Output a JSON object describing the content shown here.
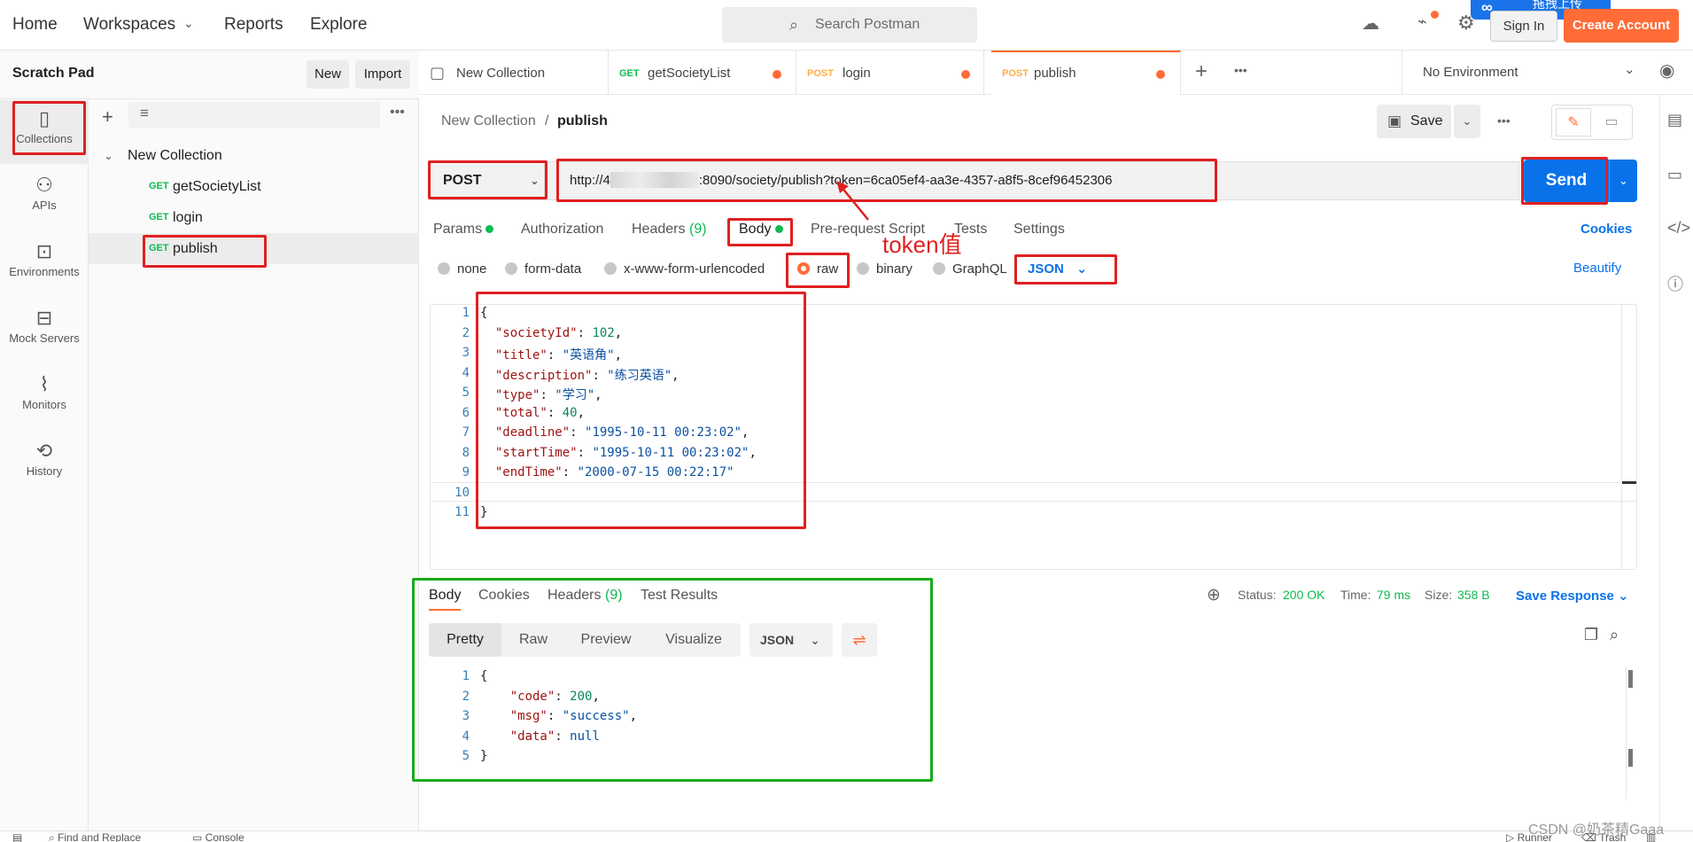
{
  "topbar": {
    "nav": [
      "Home",
      "Workspaces",
      "Reports",
      "Explore"
    ],
    "search_placeholder": "Search Postman",
    "sign_in": "Sign In",
    "create_account": "Create Account",
    "upload_badge": "拖拽上传"
  },
  "rail": {
    "items": [
      "Collections",
      "APIs",
      "Environments",
      "Mock Servers",
      "Monitors",
      "History"
    ]
  },
  "panel": {
    "title": "Scratch Pad",
    "new_label": "New",
    "import_label": "Import",
    "collection_name": "New Collection",
    "requests": [
      {
        "method": "GET",
        "name": "getSocietyList"
      },
      {
        "method": "GET",
        "name": "login"
      },
      {
        "method": "GET",
        "name": "publish"
      }
    ]
  },
  "tabs": {
    "items": [
      {
        "method": "",
        "name": "New Collection"
      },
      {
        "method": "GET",
        "name": "getSocietyList"
      },
      {
        "method": "POST",
        "name": "login"
      },
      {
        "method": "POST",
        "name": "publish"
      }
    ],
    "environment": "No Environment"
  },
  "request": {
    "breadcrumb_parent": "New Collection",
    "breadcrumb_sep": "/",
    "breadcrumb_current": "publish",
    "save_label": "Save",
    "method": "POST",
    "url_prefix": "http://4",
    "url_suffix": ":8090/society/publish?token=6ca05ef4-aa3e-4357-a8f5-8cef96452306",
    "send_label": "Send",
    "annotation": "token值",
    "subtabs": [
      "Params",
      "Authorization",
      "Headers",
      "(9)",
      "Body",
      "Pre-request Script",
      "Tests",
      "Settings"
    ],
    "cookies_label": "Cookies",
    "body_types": [
      "none",
      "form-data",
      "x-www-form-urlencoded",
      "raw",
      "binary",
      "GraphQL"
    ],
    "body_format": "JSON",
    "beautify_label": "Beautify",
    "body_lines": [
      {
        "key": "societyId",
        "value": "102",
        "kind": "n"
      },
      {
        "key": "title",
        "value": "\"英语角\"",
        "kind": "s"
      },
      {
        "key": "description",
        "value": "\"练习英语\"",
        "kind": "s"
      },
      {
        "key": "type",
        "value": "\"学习\"",
        "kind": "s"
      },
      {
        "key": "total",
        "value": "40",
        "kind": "n"
      },
      {
        "key": "deadline",
        "value": "\"1995-10-11 00:23:02\"",
        "kind": "s"
      },
      {
        "key": "startTime",
        "value": "\"1995-10-11 00:23:02\"",
        "kind": "s"
      },
      {
        "key": "endTime",
        "value": "\"2000-07-15 00:22:17\"",
        "kind": "s"
      }
    ]
  },
  "response": {
    "tabs": [
      "Body",
      "Cookies",
      "Headers",
      "(9)",
      "Test Results"
    ],
    "status_label": "Status:",
    "status_value": "200 OK",
    "time_label": "Time:",
    "time_value": "79 ms",
    "size_label": "Size:",
    "size_value": "358 B",
    "save_response": "Save Response",
    "views": [
      "Pretty",
      "Raw",
      "Preview",
      "Visualize"
    ],
    "format": "JSON",
    "lines": [
      {
        "key": "code",
        "value": "200",
        "kind": "n"
      },
      {
        "key": "msg",
        "value": "\"success\"",
        "kind": "s"
      },
      {
        "key": "data",
        "value": "null",
        "kind": "nl"
      }
    ]
  },
  "footer": {
    "find_replace": "Find and Replace",
    "console": "Console",
    "runner": "Runner",
    "trash": "Trash",
    "watermark": "CSDN @奶茶精Gaaa"
  },
  "colors": {
    "accent": "#ff6c37",
    "send": "#0a72e8",
    "annotation_red": "#e02020",
    "annotation_green": "#1aab1a"
  }
}
